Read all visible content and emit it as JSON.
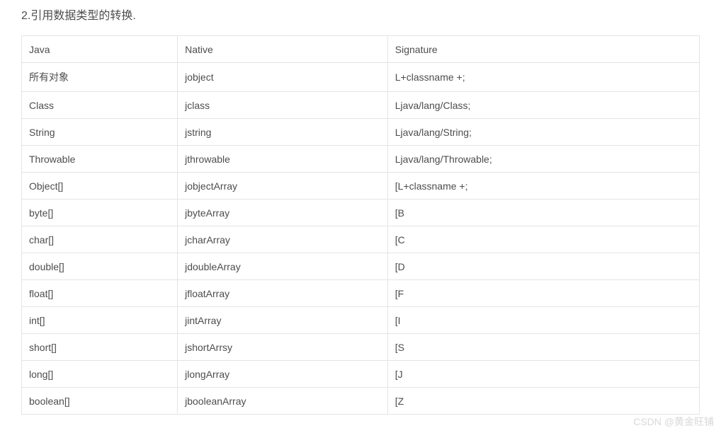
{
  "title": "2.引用数据类型的转换.",
  "headers": {
    "java": "Java",
    "native": "Native",
    "signature": "Signature"
  },
  "rows": [
    {
      "java": "所有对象",
      "native": "jobject",
      "signature": "L+classname +;"
    },
    {
      "java": "Class",
      "native": "jclass",
      "signature": "Ljava/lang/Class;"
    },
    {
      "java": "String",
      "native": "jstring",
      "signature": " Ljava/lang/String;"
    },
    {
      "java": "Throwable",
      "native": " jthrowable",
      "signature": " Ljava/lang/Throwable;"
    },
    {
      "java": "Object[]",
      "native": "jobjectArray",
      "signature": "[L+classname +;"
    },
    {
      "java": "byte[]",
      "native": " jbyteArray",
      "signature": "[B"
    },
    {
      "java": "char[]",
      "native": "jcharArray",
      "signature": "[C"
    },
    {
      "java": "double[]",
      "native": "jdoubleArray",
      "signature": " [D"
    },
    {
      "java": "float[]",
      "native": "jfloatArray",
      "signature": " [F"
    },
    {
      "java": "int[]",
      "native": " jintArray",
      "signature": "[I"
    },
    {
      "java": "short[]",
      "native": "jshortArrsy",
      "signature": "[S"
    },
    {
      "java": "long[]",
      "native": "jlongArray",
      "signature": "[J"
    },
    {
      "java": "boolean[]",
      "native": " jbooleanArray",
      "signature": " [Z"
    }
  ],
  "watermark": "CSDN @黄金旺铺"
}
